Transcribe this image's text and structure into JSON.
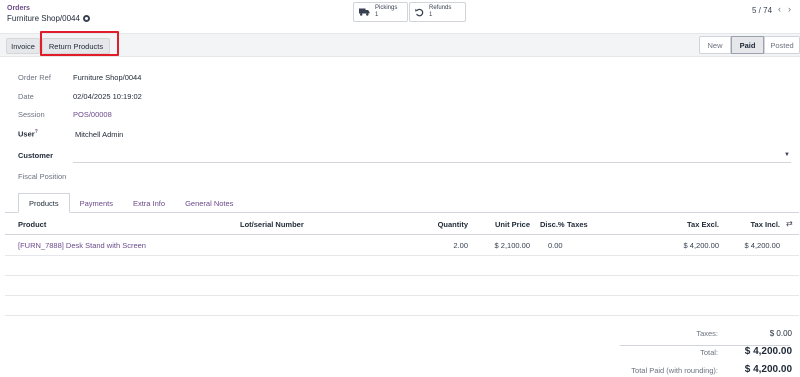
{
  "breadcrumb": {
    "parent": "Orders",
    "current": "Furniture Shop/0044"
  },
  "smart_buttons": {
    "pickings": {
      "label": "Pickings",
      "count": "1"
    },
    "refunds": {
      "label": "Refunds",
      "count": "1"
    }
  },
  "pager": {
    "text": "5 / 74"
  },
  "actions": {
    "invoice": "Invoice",
    "return_products": "Return Products"
  },
  "status": {
    "stages": [
      "New",
      "Paid",
      "Posted"
    ],
    "current": "Paid"
  },
  "fields": {
    "order_ref": {
      "label": "Order Ref",
      "value": "Furniture Shop/0044"
    },
    "date": {
      "label": "Date",
      "value": "02/04/2025 10:19:02"
    },
    "session": {
      "label": "Session",
      "value": "POS/00008"
    },
    "user": {
      "label": "User",
      "help": "?",
      "value": "Mitchell Admin"
    },
    "customer": {
      "label": "Customer",
      "value": ""
    },
    "fiscal_position": {
      "label": "Fiscal Position",
      "value": ""
    }
  },
  "tabs": [
    "Products",
    "Payments",
    "Extra Info",
    "General Notes"
  ],
  "table": {
    "columns": [
      "Product",
      "Lot/serial Number",
      "Quantity",
      "Unit Price",
      "Disc.%",
      "Taxes",
      "Tax Excl.",
      "Tax Incl."
    ],
    "rows": [
      {
        "product": "[FURN_7888] Desk Stand with Screen",
        "lot": "",
        "quantity": "2.00",
        "unit_price": "$ 2,100.00",
        "discount": "0.00",
        "taxes": "",
        "tax_excl": "$ 4,200.00",
        "tax_incl": "$ 4,200.00"
      }
    ]
  },
  "totals": {
    "taxes_label": "Taxes:",
    "taxes_value": "$ 0.00",
    "total_label": "Total:",
    "total_value": "$ 4,200.00",
    "paid_label": "Total Paid (with rounding):",
    "paid_value": "$ 4,200.00"
  },
  "colors": {
    "accent": "#6b4a8a",
    "highlight": "#e11d2a"
  }
}
